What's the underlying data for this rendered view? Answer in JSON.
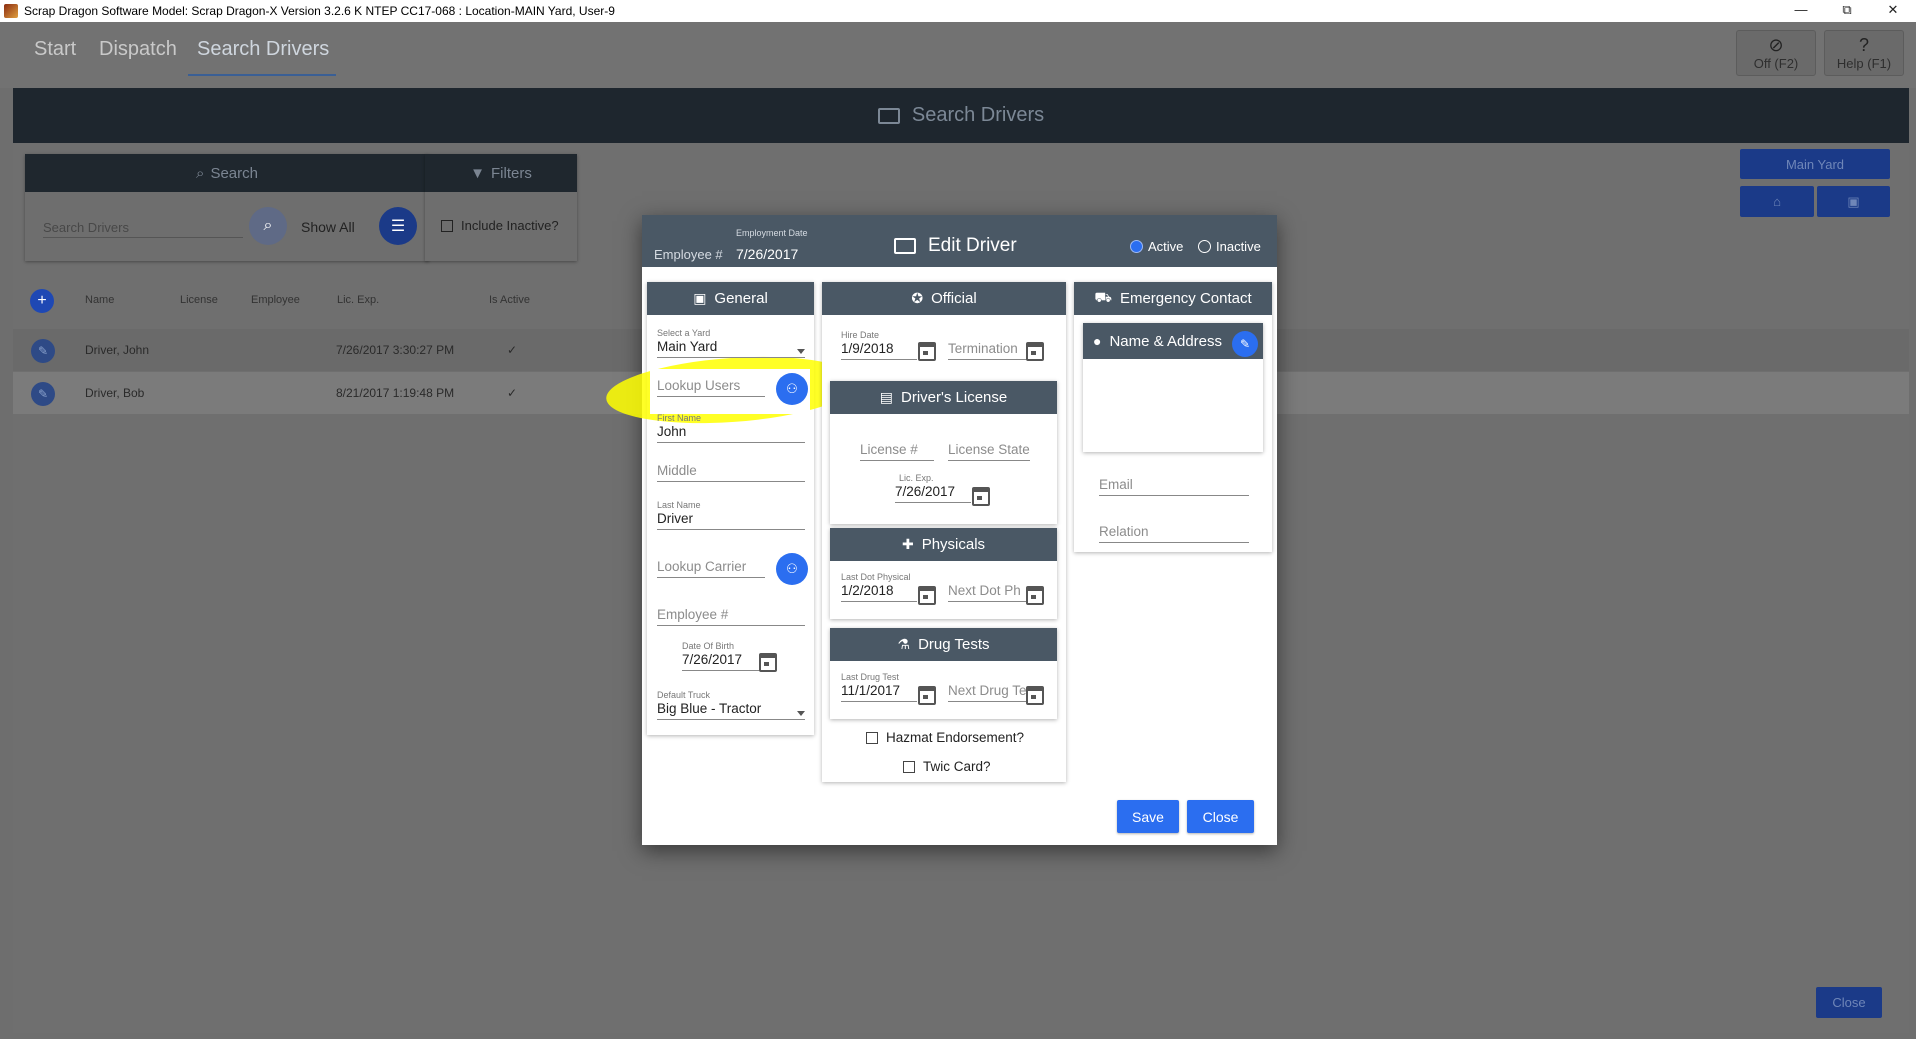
{
  "window": {
    "title": "Scrap Dragon Software Model: Scrap Dragon-X Version 3.2.6 K NTEP CC17-068 : Location-MAIN Yard, User-9",
    "controls": [
      "—",
      "⧉",
      "✕"
    ]
  },
  "nav": {
    "tabs": [
      "Start",
      "Dispatch",
      "Search Drivers"
    ],
    "off_label": "Off (F2)",
    "help_label": "Help (F1)"
  },
  "page": {
    "title": "Search Drivers",
    "search_label": "Search",
    "filters_label": "Filters",
    "search_placeholder": "Search Drivers",
    "show_all": "Show All",
    "include_inactive": "Include Inactive?",
    "yard_button": "Main Yard",
    "close_label": "Close"
  },
  "grid": {
    "columns": [
      "Name",
      "License",
      "Employee",
      "Lic. Exp.",
      "Is Active"
    ],
    "rows": [
      {
        "name": "Driver, John",
        "license": "",
        "employee": "",
        "lic_exp": "7/26/2017 3:30:27 PM",
        "active": "✓"
      },
      {
        "name": "Driver, Bob",
        "license": "",
        "employee": "",
        "lic_exp": "8/21/2017 1:19:48 PM",
        "active": "✓"
      }
    ]
  },
  "dialog": {
    "title": "Edit Driver",
    "employee_label": "Employee #",
    "employment_date_label": "Employment Date",
    "employment_date": "7/26/2017",
    "status_active": "Active",
    "status_inactive": "Inactive",
    "status_selected": "Active",
    "general": {
      "title": "General",
      "yard_label": "Select a Yard",
      "yard_value": "Main Yard",
      "lookup_users_placeholder": "Lookup Users",
      "first_name_label": "First Name",
      "first_name": "John",
      "middle_placeholder": "Middle",
      "last_name_label": "Last Name",
      "last_name": "Driver",
      "lookup_carrier_placeholder": "Lookup Carrier",
      "employee_placeholder": "Employee #",
      "dob_label": "Date Of Birth",
      "dob": "7/26/2017",
      "truck_label": "Default Truck",
      "truck_value": "Big Blue - Tractor"
    },
    "official": {
      "title": "Official",
      "hire_date_label": "Hire Date",
      "hire_date": "1/9/2018",
      "termination_placeholder": "Termination"
    },
    "license": {
      "title": "Driver's License",
      "license_placeholder": "License #",
      "state_placeholder": "License State",
      "exp_label": "Lic. Exp.",
      "exp": "7/26/2017"
    },
    "physicals": {
      "title": "Physicals",
      "last_label": "Last Dot Physical",
      "last": "1/2/2018",
      "next_placeholder": "Next Dot Ph"
    },
    "drug_tests": {
      "title": "Drug Tests",
      "last_label": "Last Drug Test",
      "last": "11/1/2017",
      "next_placeholder": "Next Drug Te"
    },
    "hazmat_label": "Hazmat Endorsement?",
    "twic_label": "Twic Card?",
    "emergency": {
      "title": "Emergency Contact",
      "name_address": "Name & Address",
      "email_placeholder": "Email",
      "relation_placeholder": "Relation"
    },
    "save_label": "Save",
    "close_label": "Close"
  },
  "colors": {
    "accent": "#2b6ef0",
    "header_dark": "#4a5865",
    "highlight": "#ffff00"
  }
}
